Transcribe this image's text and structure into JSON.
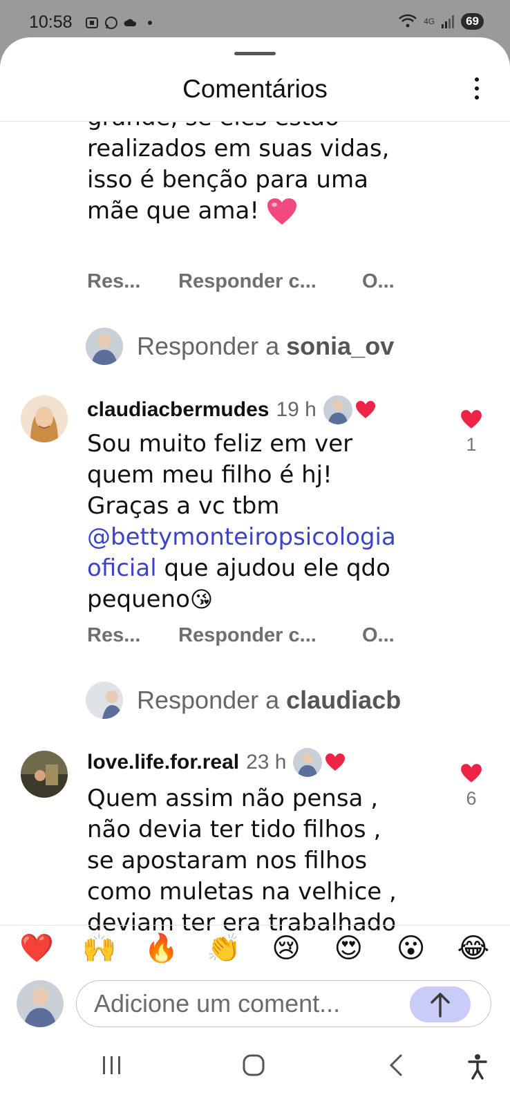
{
  "status_bar": {
    "time": "10:58",
    "network": "4G",
    "battery": "69"
  },
  "sheet": {
    "title": "Comentários"
  },
  "comments": [
    {
      "partial_text": "grande, se eles estão realizados em suas vidas, isso é benção para uma mãe que ama! ❤️",
      "lines": [
        "grande, se eles estão",
        "realizados em suas vidas,",
        "isso é benção para uma",
        "mãe que ama!"
      ],
      "actions": [
        "Res...",
        "Responder c...",
        "O..."
      ],
      "reply_prompt": {
        "prefix": "Responder a",
        "user": "sonia_ov"
      }
    },
    {
      "user": "claudiacbermudes",
      "time": "19 h",
      "line1": "Sou muito feliz em ver",
      "line2": "quem meu filho é hj!",
      "line3": "Graças a vc tbm",
      "mention_a": "@bettymonteiropsicologia",
      "mention_b": "oficial",
      "line5_rest": " que ajudou ele qdo",
      "line6": "pequeno",
      "emoji": "😘",
      "likes": "1",
      "actions": [
        "Res...",
        "Responder c...",
        "O..."
      ],
      "reply_prompt": {
        "prefix": "Responder a",
        "user": "claudiacb"
      }
    },
    {
      "user": "love.life.for.real",
      "time": "23 h",
      "lines": [
        "Quem assim não pensa ,",
        "não devia ter tido  filhos ,",
        "se apostaram nos filhos",
        "como muletas na velhice ,",
        "deviam ter era trabalhado"
      ],
      "likes": "6"
    }
  ],
  "emoji_bar": [
    "❤️",
    "🙌",
    "🔥",
    "👏",
    "😢",
    "😍",
    "😮",
    "😂"
  ],
  "composer": {
    "placeholder": "Adicione um coment..."
  },
  "colors": {
    "accent": "#3b44c9",
    "heart": "#ed2448",
    "send_bg": "#c8ccf6"
  },
  "icons": [
    "more-vertical-icon",
    "heart-icon",
    "send-arrow-icon",
    "recent-apps-icon",
    "home-icon",
    "back-icon",
    "accessibility-icon"
  ]
}
